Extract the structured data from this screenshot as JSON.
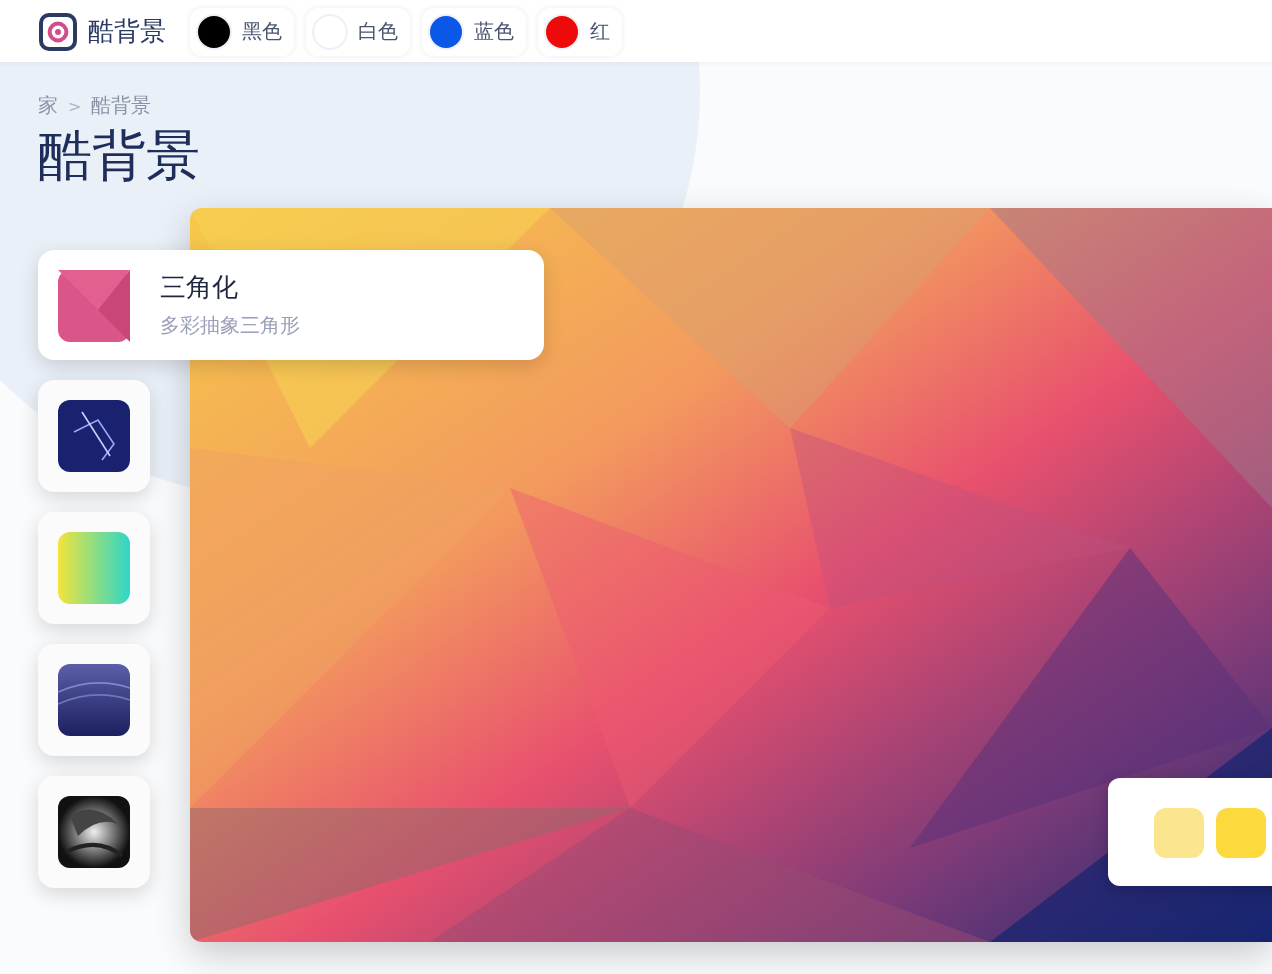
{
  "header": {
    "logo_text": "酷背景",
    "colors": [
      {
        "label": "黑色",
        "color": "#000000",
        "selected": false
      },
      {
        "label": "白色",
        "color": "#ffffff",
        "selected": false
      },
      {
        "label": "蓝色",
        "color": "#0b57e8",
        "selected": false
      },
      {
        "label": "红",
        "color": "#ee0a0a",
        "selected": false
      }
    ]
  },
  "breadcrumb": [
    {
      "label": "家"
    },
    {
      "label": ">",
      "kind": "separator"
    },
    {
      "label": "酷背景"
    }
  ],
  "page_title": "酷背景",
  "styles": [
    {
      "title": "三角化",
      "subtitle": "多彩抽象三角形",
      "selected": true,
      "kind": "triangles"
    },
    {
      "selected": false,
      "kind": "network"
    },
    {
      "selected": false,
      "kind": "gradient"
    },
    {
      "selected": false,
      "kind": "waves"
    },
    {
      "selected": false,
      "kind": "swirl"
    }
  ],
  "palette": [
    {
      "color": "#fbe58f",
      "selected": false
    },
    {
      "color": "#fcd93c",
      "selected": false
    }
  ]
}
